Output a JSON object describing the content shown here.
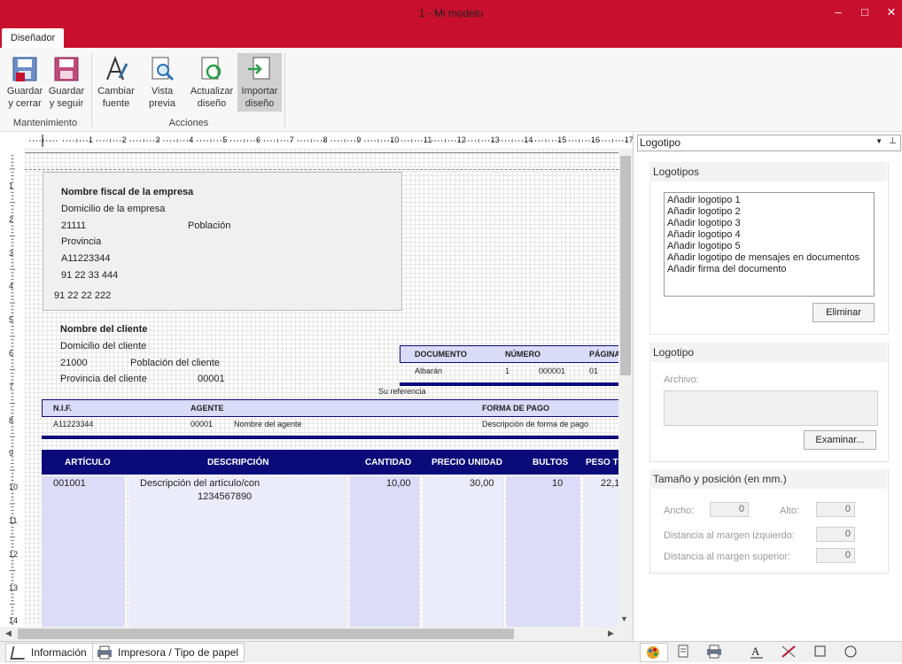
{
  "window": {
    "title": "1 - Mi modelo",
    "minimize": "‒",
    "maximize": "□",
    "close": "✕"
  },
  "ribbon": {
    "tab": "Diseñador",
    "groups": [
      {
        "label": "Mantenimiento"
      },
      {
        "label": "Acciones"
      }
    ],
    "buttons": [
      {
        "line1": "Guardar",
        "line2": "y cerrar"
      },
      {
        "line1": "Guardar",
        "line2": "y seguir"
      },
      {
        "line1": "Cambiar",
        "line2": "fuente"
      },
      {
        "line1": "Vista",
        "line2": "previa"
      },
      {
        "line1": "Actualizar",
        "line2": "diseño"
      },
      {
        "line1": "Importar",
        "line2": "diseño"
      }
    ]
  },
  "ruler": {
    "top": [
      "1",
      "2",
      "3",
      "4",
      "5",
      "6",
      "7",
      "8",
      "9",
      "10",
      "11",
      "12",
      "13",
      "14",
      "15",
      "16",
      "17"
    ],
    "left": [
      "1",
      "2",
      "3",
      "4",
      "5",
      "6",
      "7",
      "8",
      "9",
      "10",
      "11",
      "12",
      "13",
      "14"
    ]
  },
  "doc": {
    "company": {
      "name": "Nombre fiscal de la empresa",
      "address": "Domicilio de la empresa",
      "zip": "21111",
      "city": "Población",
      "province": "Provincia",
      "nif": "A11223344",
      "phone1": "91 22 33 444",
      "phone2": "91 22 22 222"
    },
    "client": {
      "name": "Nombre del cliente",
      "address": "Domicilio del cliente",
      "zip": "21000",
      "city": "Población del cliente",
      "province": "Provincia del cliente",
      "code": "00001"
    },
    "docbox": {
      "h1": "DOCUMENTO",
      "h2": "NÚMERO",
      "h3": "PÁGINA",
      "v1": "Albarán",
      "v2a": "1",
      "v2b": "000001",
      "v3": "01"
    },
    "ref": "Su referencia",
    "info": {
      "h1": "N.I.F.",
      "h2": "AGENTE",
      "h3": "FORMA DE PAGO",
      "v1": "A11223344",
      "v2a": "00001",
      "v2b": "Nombre del agente",
      "v3": "Descripción de forma de pago"
    },
    "lines": {
      "headers": [
        "ARTÍCULO",
        "DESCRIPCIÓN",
        "CANTIDAD",
        "PRECIO UNIDAD",
        "BULTOS",
        "PESO TO"
      ],
      "row": {
        "code": "001001",
        "desc1": "Descripción del artículo/con",
        "desc2": "1234567890",
        "qty": "10,00",
        "price": "30,00",
        "packs": "10",
        "weight": "22,1"
      }
    }
  },
  "panel": {
    "combo_value": "Logotipo",
    "logos_title": "Logotipos",
    "logos": [
      "Añadir logotipo 1",
      "Añadir logotipo 2",
      "Añadir logotipo 3",
      "Añadir logotipo 4",
      "Añadir logotipo 5",
      "Añadir logotipo de mensajes en documentos",
      "Añadir firma del documento"
    ],
    "remove_label": "Eliminar",
    "logo_title": "Logotipo",
    "file_label": "Archivo:",
    "browse_label": "Examinar...",
    "size_title": "Tamaño y posición (en mm.)",
    "width_label": "Ancho:",
    "width_value": "0",
    "height_label": "Alto:",
    "height_value": "0",
    "left_label": "Distancia al margen izquierdo:",
    "left_value": "0",
    "top_label": "Distancia al margen superior:",
    "top_value": "0"
  },
  "bottom": {
    "tab1": "Información",
    "tab2": "Impresora / Tipo de papel"
  },
  "colors": {
    "accent": "#c8102e",
    "header_dark": "#0a0a7a",
    "header_light": "#d9dbf7",
    "column_fill": "#dcdcf8"
  }
}
